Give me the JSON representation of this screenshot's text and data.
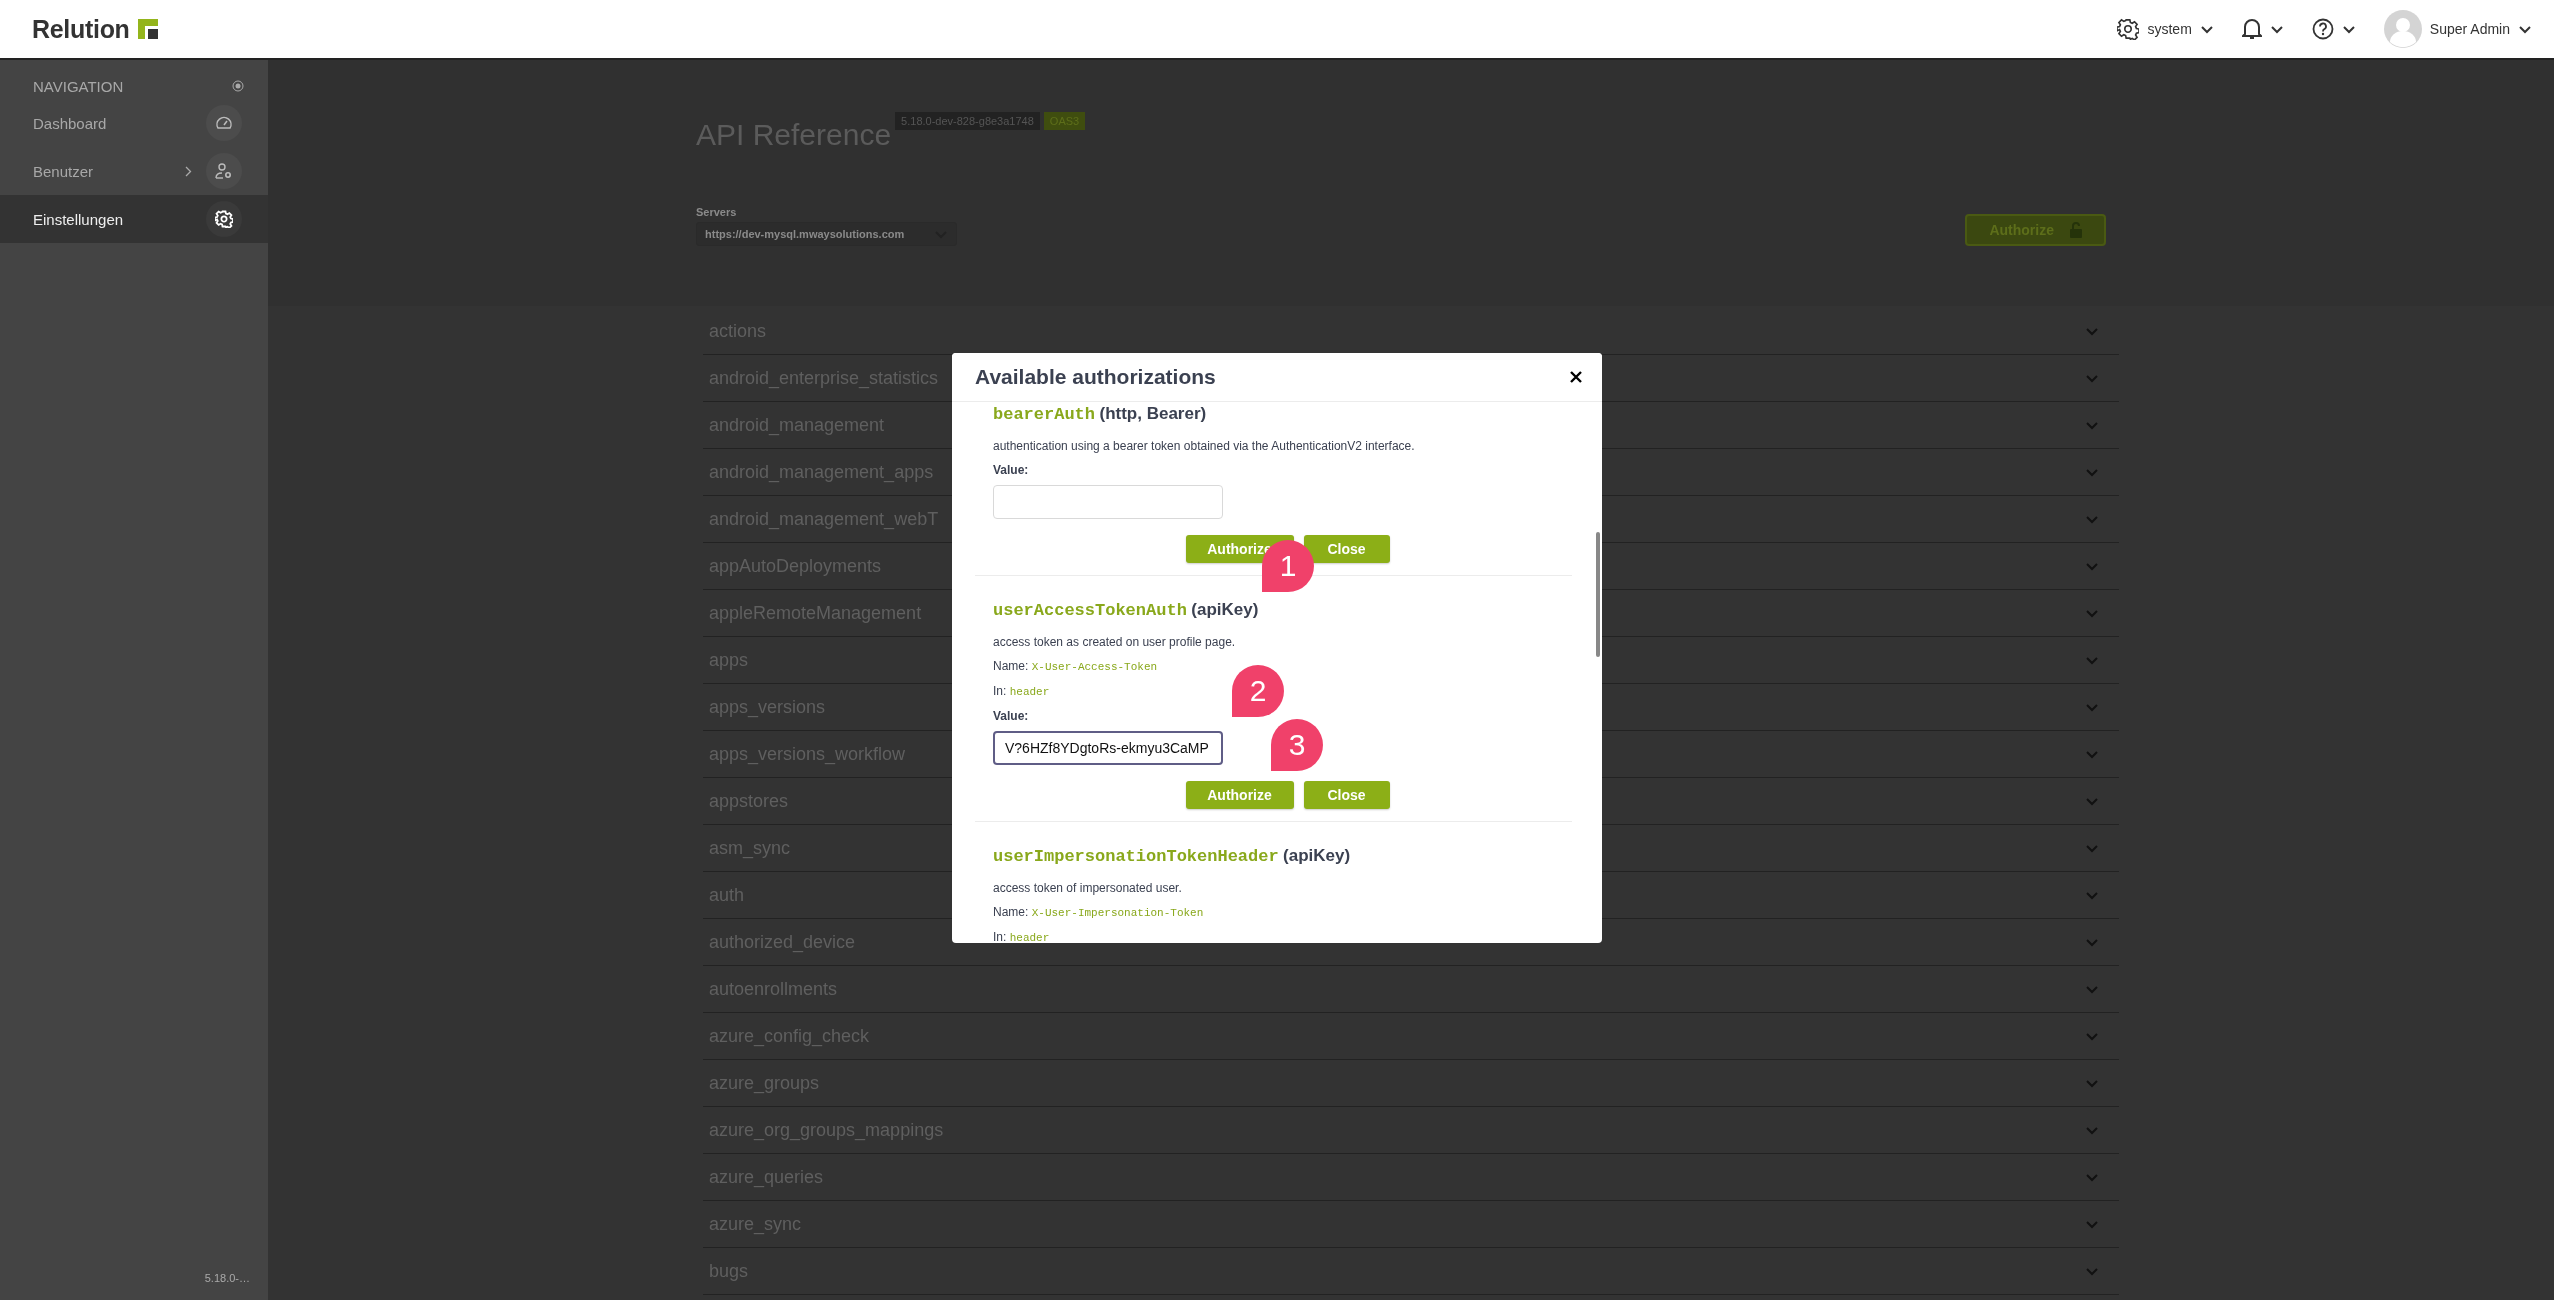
{
  "header": {
    "brand": "Relution",
    "workspace": "system",
    "user": "Super Admin"
  },
  "sidebar": {
    "heading": "NAVIGATION",
    "items": [
      {
        "label": "Dashboard",
        "selected": false,
        "expandable": false
      },
      {
        "label": "Benutzer",
        "selected": false,
        "expandable": true
      },
      {
        "label": "Einstellungen",
        "selected": true,
        "expandable": false
      }
    ],
    "version": "5.18.0-…"
  },
  "page": {
    "title": "API Reference",
    "version_badge": "5.18.0-dev-828-g8e3a1748",
    "spec_badge": "OAS3",
    "servers_label": "Servers",
    "server": "https://dev-mysql.mwaysolutions.com",
    "authorize_button": "Authorize"
  },
  "tags": [
    "actions",
    "android_enterprise_statistics",
    "android_management",
    "android_management_apps",
    "android_management_webT",
    "appAutoDeployments",
    "appleRemoteManagement",
    "apps",
    "apps_versions",
    "apps_versions_workflow",
    "appstores",
    "asm_sync",
    "auth",
    "authorized_device",
    "autoenrollments",
    "azure_config_check",
    "azure_groups",
    "azure_org_groups_mappings",
    "azure_queries",
    "azure_sync",
    "bugs"
  ],
  "modal": {
    "title": "Available authorizations",
    "schemes": [
      {
        "name": "bearerAuth",
        "type": "(http, Bearer)",
        "description": "authentication using a bearer token obtained via the AuthenticationV2 interface.",
        "value_label": "Value:",
        "focused": false,
        "buttons": [
          "Authorize",
          "Close"
        ]
      },
      {
        "name": "userAccessTokenAuth",
        "type": "(apiKey)",
        "description": "access token as created on user profile page.",
        "name_label": "Name:",
        "header_name": "X-User-Access-Token",
        "in_label": "In:",
        "in": "header",
        "value_label": "Value:",
        "value": "V?6HZf8YDgtoRs-ekmyu3CaMP",
        "focused": true,
        "buttons": [
          "Authorize",
          "Close"
        ]
      },
      {
        "name": "userImpersonationTokenHeader",
        "type": "(apiKey)",
        "description": "access token of impersonated user.",
        "name_label": "Name:",
        "header_name": "X-User-Impersonation-Token",
        "in_label": "In:",
        "in": "header"
      }
    ]
  },
  "markers": [
    {
      "label": "1"
    },
    {
      "label": "2"
    },
    {
      "label": "3"
    }
  ]
}
